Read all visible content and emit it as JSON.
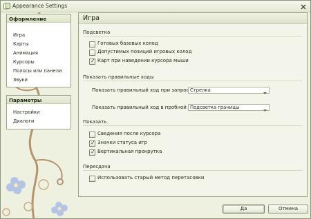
{
  "window": {
    "title": "Appearance Settings"
  },
  "sidebar": {
    "appearance": {
      "header": "Оформление",
      "items": [
        "Игра",
        "Карты",
        "Анимация",
        "Курсоры",
        "Полосы или панели",
        "Звуки"
      ]
    },
    "parameters": {
      "header": "Параметры",
      "items": [
        "Настройки",
        "Диалоги"
      ]
    }
  },
  "content": {
    "title": "Игра",
    "highlight": {
      "label": "Подсветка",
      "options": [
        {
          "label": "Готовых базовых колод",
          "checked": false
        },
        {
          "label": "Допустимых позиций игровых колод",
          "checked": false
        },
        {
          "label": "Карт при наведении курсора мыши",
          "checked": true
        }
      ]
    },
    "show_moves": {
      "label": "Показать правильные ходы",
      "on_request": {
        "label": "Показать правильный ход при запросе (N",
        "value": "Стрелка"
      },
      "trial": {
        "label": "Показать правильный ход в пробной игр",
        "value": "Подсветка границы"
      }
    },
    "show": {
      "label": "Показать",
      "options": [
        {
          "label": "Сведения после курсора",
          "checked": false
        },
        {
          "label": "Значки статуса игр",
          "checked": true
        },
        {
          "label": "Вертикальная прокрутка",
          "checked": true
        }
      ]
    },
    "transfer": {
      "label": "Пересдача",
      "options": [
        {
          "label": "Использовать старый метод перетасовки",
          "checked": false
        }
      ]
    }
  },
  "buttons": {
    "ok": "Да",
    "cancel": "Отмена"
  },
  "colors": {
    "accent_header": "#dde3c8",
    "art_flower": "#b08c66",
    "art_blue": "#9fb3e4"
  }
}
